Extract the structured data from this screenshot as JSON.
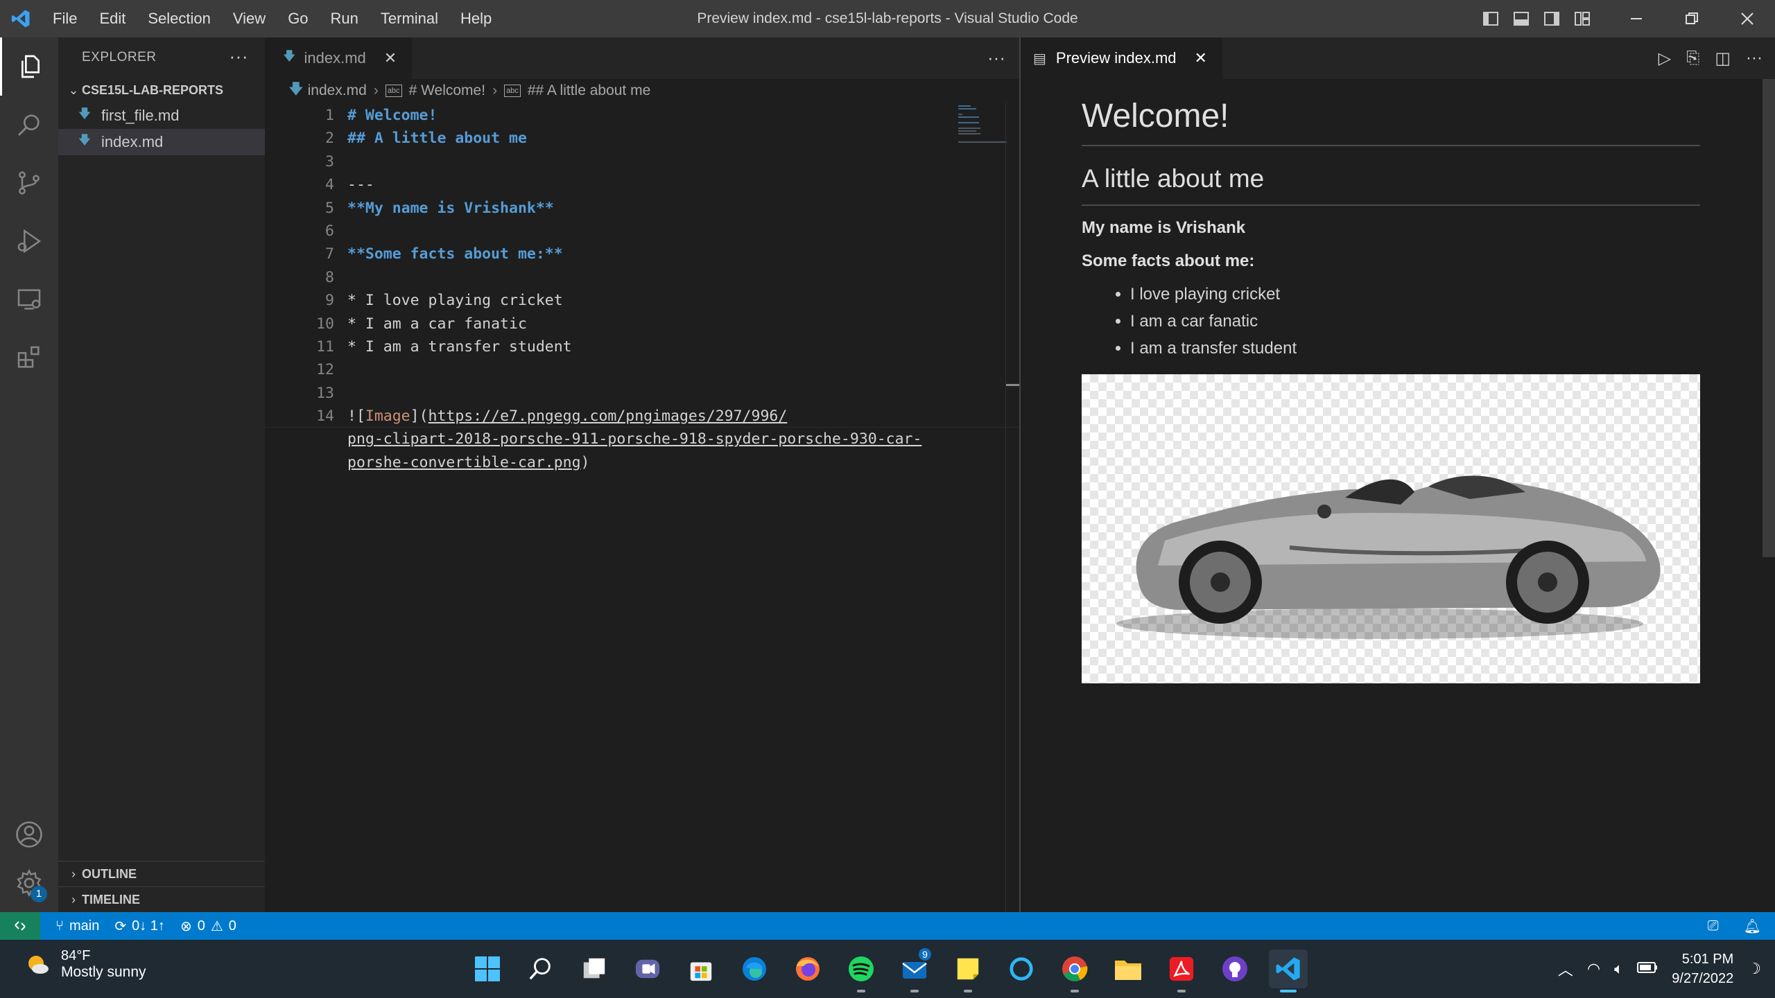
{
  "titlebar": {
    "menu": [
      "File",
      "Edit",
      "Selection",
      "View",
      "Go",
      "Run",
      "Terminal",
      "Help"
    ],
    "title": "Preview index.md - cse15l-lab-reports - Visual Studio Code"
  },
  "sidebar": {
    "header": "EXPLORER",
    "folder": "CSE15L-LAB-REPORTS",
    "files": [
      "first_file.md",
      "index.md"
    ],
    "selected_file": "index.md",
    "outline": "OUTLINE",
    "timeline": "TIMELINE"
  },
  "activitybar": {
    "icons": [
      "explorer-icon",
      "search-icon",
      "source-control-icon",
      "run-debug-icon",
      "remote-explorer-icon",
      "extensions-icon",
      "accounts-icon",
      "manage-gear-icon"
    ],
    "manage_badge": "1"
  },
  "editor": {
    "tab_label": "index.md",
    "breadcrumbs": [
      "index.md",
      "# Welcome!",
      "## A little about me"
    ],
    "lines": [
      {
        "n": "1",
        "text": "# Welcome!"
      },
      {
        "n": "2",
        "text": "## A little about me"
      },
      {
        "n": "3",
        "text": ""
      },
      {
        "n": "4",
        "text": "---"
      },
      {
        "n": "5",
        "text": "**My name is Vrishank**"
      },
      {
        "n": "6",
        "text": ""
      },
      {
        "n": "7",
        "text": "**Some facts about me:**"
      },
      {
        "n": "8",
        "text": ""
      },
      {
        "n": "9",
        "text": "* I love playing cricket"
      },
      {
        "n": "10",
        "text": "* I am a car fanatic"
      },
      {
        "n": "11",
        "text": "* I am a transfer student"
      },
      {
        "n": "12",
        "text": ""
      },
      {
        "n": "13",
        "text": ""
      },
      {
        "n": "14",
        "text": "![Image](https://e7.pngegg.com/pngimages/297/996/"
      }
    ],
    "line14_open": "![",
    "line14_linktext": "Image",
    "line14_mid": "](",
    "line14_url1": "https://e7.pngegg.com/pngimages/297/996/",
    "wrap1": "png-clipart-2018-porsche-911-porsche-918-spyder-porsche-930-car-",
    "wrap2_url": "porshe-convertible-car.png",
    "wrap2_close": ")"
  },
  "preview": {
    "tab_label": "Preview index.md",
    "h1": "Welcome!",
    "h2": "A little about me",
    "name": "My name is Vrishank",
    "facts_title": "Some facts about me:",
    "facts": [
      "I love playing cricket",
      "I am a car fanatic",
      "I am a transfer student"
    ]
  },
  "statusbar": {
    "branch": "main",
    "sync": "0↓ 1↑",
    "errors": "0",
    "warnings": "0"
  },
  "taskbar": {
    "temperature": "84°F",
    "weather": "Mostly sunny",
    "time": "5:01 PM",
    "date": "9/27/2022",
    "mail_badge": "9",
    "apps": [
      "start-icon",
      "search-icon",
      "task-view-icon",
      "teams-chat-icon",
      "store-icon",
      "edge-icon",
      "firefox-icon",
      "spotify-icon",
      "mail-icon",
      "sticky-notes-icon",
      "cortana-icon",
      "chrome-icon",
      "file-explorer-icon",
      "acrobat-icon",
      "github-desktop-icon",
      "vscode-icon"
    ]
  },
  "colors": {
    "accent": "#007acc",
    "heading": "#569cd6",
    "link_text": "#ce9178",
    "remote": "#16825d"
  }
}
